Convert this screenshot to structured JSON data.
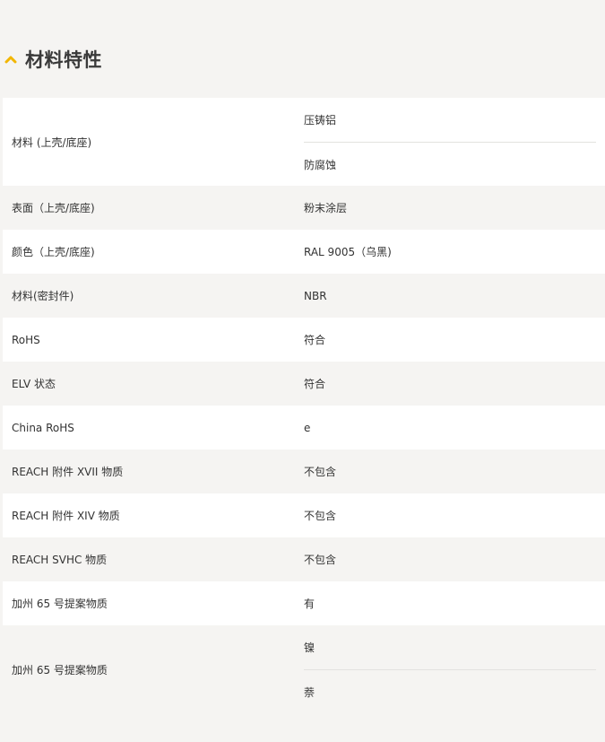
{
  "section": {
    "title": "材料特性",
    "icon": "chevron-up-icon",
    "accent": "#f2b600"
  },
  "rows": [
    {
      "label": "材料 (上壳/底座)",
      "values": [
        "压铸铝",
        "防腐蚀"
      ]
    },
    {
      "label": "表面（上壳/底座)",
      "values": [
        "粉末涂层"
      ]
    },
    {
      "label": "颜色（上壳/底座)",
      "values": [
        "RAL 9005（乌黑)"
      ]
    },
    {
      "label": "材料(密封件)",
      "values": [
        "NBR"
      ]
    },
    {
      "label": "RoHS",
      "values": [
        "符合"
      ]
    },
    {
      "label": "ELV 状态",
      "values": [
        "符合"
      ]
    },
    {
      "label": "China RoHS",
      "values": [
        "e"
      ]
    },
    {
      "label": "REACH 附件 XVII 物质",
      "values": [
        "不包含"
      ]
    },
    {
      "label": "REACH 附件 XIV 物质",
      "values": [
        "不包含"
      ]
    },
    {
      "label": "REACH SVHC 物质",
      "values": [
        "不包含"
      ]
    },
    {
      "label": "加州 65 号提案物质",
      "values": [
        "有"
      ]
    },
    {
      "label": "加州 65 号提案物质",
      "values": [
        "镍",
        "萘"
      ]
    }
  ]
}
